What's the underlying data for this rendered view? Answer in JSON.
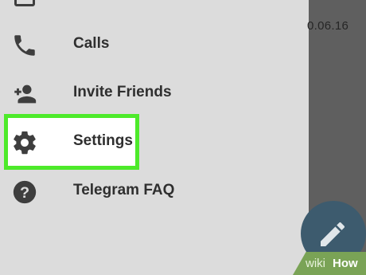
{
  "drawer": {
    "items": [
      {
        "label": "Calls",
        "icon": "phone-icon"
      },
      {
        "label": "Invite Friends",
        "icon": "add-person-icon"
      },
      {
        "label": "Settings",
        "icon": "gear-icon",
        "highlighted": true
      },
      {
        "label": "Telegram FAQ",
        "icon": "help-icon"
      }
    ]
  },
  "background": {
    "date_text": "0.06.16"
  },
  "watermark": {
    "wiki": "wiki",
    "how": "How"
  },
  "colors": {
    "drawer_bg": "#dcdcdc",
    "highlight_border": "#4dea2a",
    "icon": "#3e3e3e",
    "fab": "#3d5b6e"
  }
}
